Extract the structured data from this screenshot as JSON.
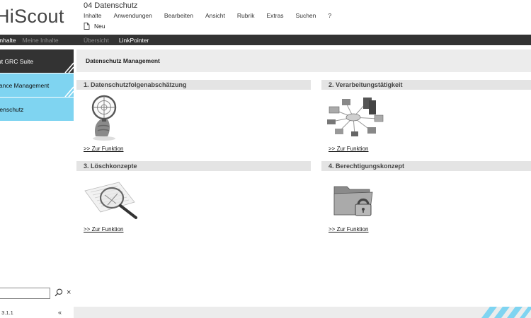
{
  "header": {
    "logo": "HiScout",
    "document_title": "04 Datenschutz",
    "menu": [
      "Inhalte",
      "Anwendungen",
      "Bearbeiten",
      "Ansicht",
      "Rubrik",
      "Extras",
      "Suchen",
      "?"
    ],
    "new_label": "Neu"
  },
  "navbar": {
    "left_tabs": [
      "Inhalte",
      "Meine Inhalte"
    ],
    "right_tabs": [
      "Übersicht",
      "LinkPointer"
    ],
    "active_right": "LinkPointer"
  },
  "sidebar": {
    "items": [
      {
        "label": "ut GRC Suite",
        "style": "dark"
      },
      {
        "label": "iance Management",
        "style": "blue"
      },
      {
        "label": "tenschutz",
        "style": "blue"
      }
    ],
    "search_value": "",
    "version": ": 3.1.1",
    "collapse_symbol": "«"
  },
  "main": {
    "title": "Datenschutz Management",
    "sections": [
      {
        "heading": "1. Datenschutzfolgenabschätzung",
        "icon": "target-magnifier-icon",
        "link": ">> Zur Funktion"
      },
      {
        "heading": "2. Verarbeitungstätigkeit",
        "icon": "network-devices-icon",
        "link": ">> Zur Funktion"
      },
      {
        "heading": "3. Löschkonzepte",
        "icon": "magnifier-document-icon",
        "link": ">> Zur Funktion"
      },
      {
        "heading": "4. Berechtigungskonzept",
        "icon": "padlock-folder-icon",
        "link": ">> Zur Funktion"
      }
    ]
  },
  "colors": {
    "dark": "#333333",
    "accent_blue": "#7fd4f1",
    "section_bg": "#e4e4e4"
  }
}
